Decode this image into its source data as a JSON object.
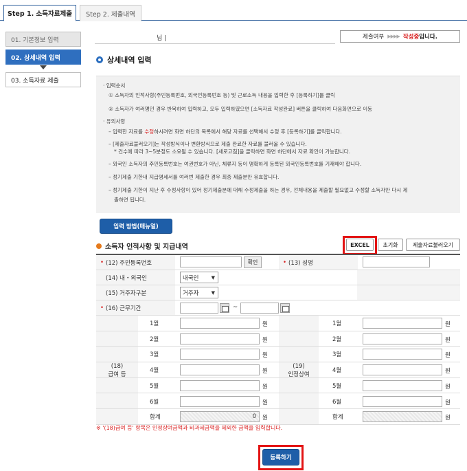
{
  "tabs": [
    {
      "label": "Step 1. 소득자료제출",
      "active": true
    },
    {
      "label": "Step 2. 제출내역",
      "active": false
    }
  ],
  "steps": [
    {
      "label": "01. 기본정보 입력"
    },
    {
      "label": "02. 상세내역 입력"
    },
    {
      "label": "03. 소득자료 제출"
    }
  ],
  "header": {
    "name_suffix": "님 |",
    "status_label": "제출여부",
    "status_arrows": "▶▶▶▶",
    "status_value": "작성중",
    "status_tail": "입니다."
  },
  "section_title": "상세내역 입력",
  "info": {
    "lines": [
      "· 입력순서",
      "① 소득자의 인적사항(주민등록번호, 외국인등록번호 등) 및 근로소득 내용을 입력한 후 [등록하기]를 클릭",
      "② 소득자가 여러명인 경우 반복하여 입력하고, 모두 입력하였으면 [소득자료 작성완료] 버튼을 클릭하여 다음화면으로 이동",
      "· 유의사항",
      "– 입력한 자료를 ",
      "수정",
      "하시려면 화면 하단의 목록에서 해당 자료를 선택해서 수정 후 [등록하기]를 클릭합니다.",
      "– [제출자료불러오기]는 작성방식이나 변환방식으로 제출 완료한 자료를 불러올 수 있습니다.",
      "* 건수에 따라 3~5분정도 소요될 수 있습니다. [새로고침]을 클릭하면 화면 하단에서 자료 확인이 가능합니다.",
      "– 외국인 소득자의 주민등록번호는 여권번호가 아닌, 체류지 등이 명확하게 등록된 외국인등록번호를 기재해야 합니다.",
      "– 정기제출 기한내 지급명세서를 여러번 제출한 경우 최종 제출분만 유효합니다.",
      "– 정기제출 기한이 지난 후 수정사항이 있어 정기제출분에 대해 수정제출을 하는 경우, 전체내용을 제출할 필요없고 수정할 소득자만 다시 제",
      "출하면 됩니다."
    ]
  },
  "manual_button": "입력 방법(매뉴얼)",
  "subsection_title": "소득자 인적사항 및 지급내역",
  "buttons": {
    "excel": "EXCEL",
    "reset": "초기화",
    "load": "제출자료불러오기",
    "register": "등록하기"
  },
  "form": {
    "rrn_label": "(12) 주민등록번호",
    "confirm_label": "확인",
    "name_label": "(13) 성명",
    "nationality_label": "(14) 내・외국인",
    "nationality_value": "내국인",
    "residence_label": "(15) 거주자구분",
    "residence_value": "거주자",
    "period_label": "(16) 근무기간",
    "tilde": "~",
    "pay_label_num": "(18)",
    "pay_label": "급여 등",
    "bonus_label_num": "(19)",
    "bonus_label": "인정상여",
    "months": [
      "1월",
      "2월",
      "3월",
      "4월",
      "5월",
      "6월"
    ],
    "total_label": "합계",
    "pay_total": "0",
    "unit": "원"
  },
  "note": "※ '(18)급여 등' 항목은 인정상여금액과 비과세금액을 제외한 금액을 입력합니다."
}
